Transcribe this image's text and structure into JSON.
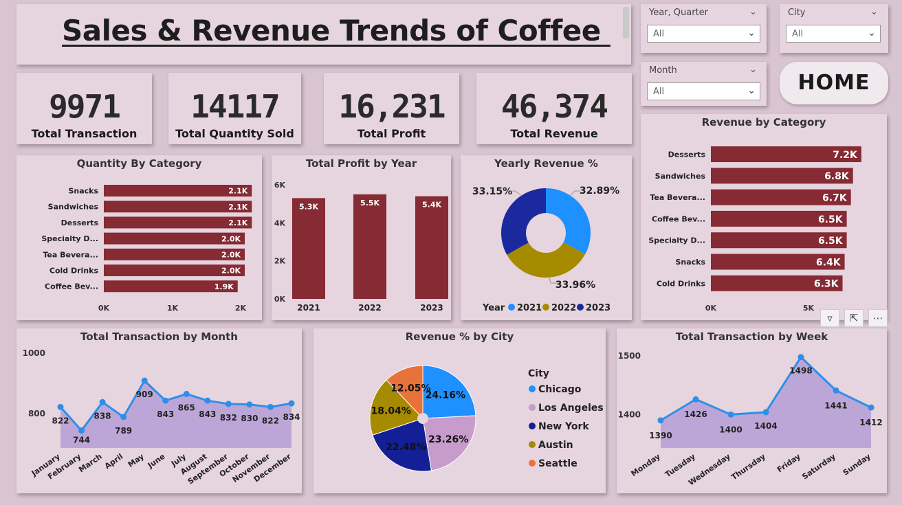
{
  "title": "Sales & Revenue Trends of Coffee ",
  "slicers": [
    {
      "label": "Year, Quarter",
      "value": "All"
    },
    {
      "label": "City",
      "value": "All"
    },
    {
      "label": "Month",
      "value": "All"
    }
  ],
  "home_label": "HOME",
  "kpis": [
    {
      "value": "9971",
      "label": "Total Transaction"
    },
    {
      "value": "14117",
      "label": "Total Quantity Sold"
    },
    {
      "value": "16,231",
      "label": "Total Profit"
    },
    {
      "value": "46,374",
      "label": "Total Revenue"
    }
  ],
  "visual_buttons": [
    "filter-icon",
    "focus-mode-icon",
    "more-options-icon"
  ],
  "chart_data": [
    {
      "id": "quantity_by_category",
      "type": "bar",
      "orientation": "horizontal",
      "title": "Quantity By Category",
      "categories": [
        "Snacks",
        "Sandwiches",
        "Desserts",
        "Specialty D...",
        "Tea Bevera...",
        "Cold Drinks",
        "Coffee Bev..."
      ],
      "values": [
        2100,
        2100,
        2100,
        2000,
        2000,
        2000,
        1900
      ],
      "data_labels": [
        "2.1K",
        "2.1K",
        "2.1K",
        "2.0K",
        "2.0K",
        "2.0K",
        "1.9K"
      ],
      "x_ticks": [
        "0K",
        "1K",
        "2K"
      ],
      "xlim": [
        0,
        2000
      ],
      "color": "#862a33"
    },
    {
      "id": "total_profit_by_year",
      "type": "bar",
      "title": "Total Profit by Year",
      "categories": [
        "2021",
        "2022",
        "2023"
      ],
      "values": [
        5300,
        5500,
        5400
      ],
      "data_labels": [
        "5.3K",
        "5.5K",
        "5.4K"
      ],
      "y_ticks": [
        "0K",
        "2K",
        "4K",
        "6K"
      ],
      "ylim": [
        0,
        6000
      ],
      "color": "#862a33"
    },
    {
      "id": "yearly_revenue_pct",
      "type": "pie",
      "donut": true,
      "title": "Yearly Revenue %",
      "legend_title": "Year",
      "slices": [
        {
          "label": "2021",
          "value": 32.89,
          "text": "32.89%",
          "color": "#1e90ff"
        },
        {
          "label": "2022",
          "value": 33.96,
          "text": "33.96%",
          "color": "#a68a00"
        },
        {
          "label": "2023",
          "value": 33.15,
          "text": "33.15%",
          "color": "#1a2a9e"
        }
      ]
    },
    {
      "id": "revenue_by_category",
      "type": "bar",
      "orientation": "horizontal",
      "title": "Revenue by Category",
      "categories": [
        "Desserts",
        "Sandwiches",
        "Tea Bevera...",
        "Coffee Bev...",
        "Specialty D...",
        "Snacks",
        "Cold Drinks"
      ],
      "values": [
        7200,
        6800,
        6700,
        6500,
        6500,
        6400,
        6300
      ],
      "data_labels": [
        "7.2K",
        "6.8K",
        "6.7K",
        "6.5K",
        "6.5K",
        "6.4K",
        "6.3K"
      ],
      "x_ticks": [
        "0K",
        "5K"
      ],
      "xlim": [
        0,
        7500
      ],
      "color": "#862a33"
    },
    {
      "id": "transaction_by_month",
      "type": "area",
      "title": "Total Transaction by Month",
      "categories": [
        "January",
        "February",
        "March",
        "April",
        "May",
        "June",
        "July",
        "August",
        "September",
        "October",
        "November",
        "December"
      ],
      "values": [
        822,
        744,
        838,
        789,
        909,
        843,
        865,
        843,
        832,
        830,
        822,
        834
      ],
      "y_ticks": [
        "800",
        "1000"
      ],
      "ylim": [
        700,
        1000
      ],
      "line_color": "#2f8fe8",
      "fill_color": "#b9a3d6"
    },
    {
      "id": "revenue_pct_by_city",
      "type": "pie",
      "title": "Revenue % by City",
      "legend_title": "City",
      "slices": [
        {
          "label": "Chicago",
          "value": 24.16,
          "text": "24.16%",
          "color": "#1e90ff"
        },
        {
          "label": "Los Angeles",
          "value": 23.26,
          "text": "23.26%",
          "color": "#c79ccc"
        },
        {
          "label": "New York",
          "value": 22.48,
          "text": "22.48%",
          "color": "#141f96"
        },
        {
          "label": "Austin",
          "value": 18.04,
          "text": "18.04%",
          "color": "#a68a00"
        },
        {
          "label": "Seattle",
          "value": 12.05,
          "text": "12.05%",
          "color": "#e8733a"
        }
      ]
    },
    {
      "id": "transaction_by_week",
      "type": "area",
      "title": "Total Transaction by Week",
      "categories": [
        "Monday",
        "Tuesday",
        "Wednesday",
        "Thursday",
        "Friday",
        "Saturday",
        "Sunday"
      ],
      "values": [
        1390,
        1426,
        1400,
        1404,
        1498,
        1441,
        1412
      ],
      "y_ticks": [
        "1400",
        "1500"
      ],
      "ylim": [
        1350,
        1500
      ],
      "line_color": "#2f8fe8",
      "fill_color": "#b9a3d6"
    }
  ]
}
